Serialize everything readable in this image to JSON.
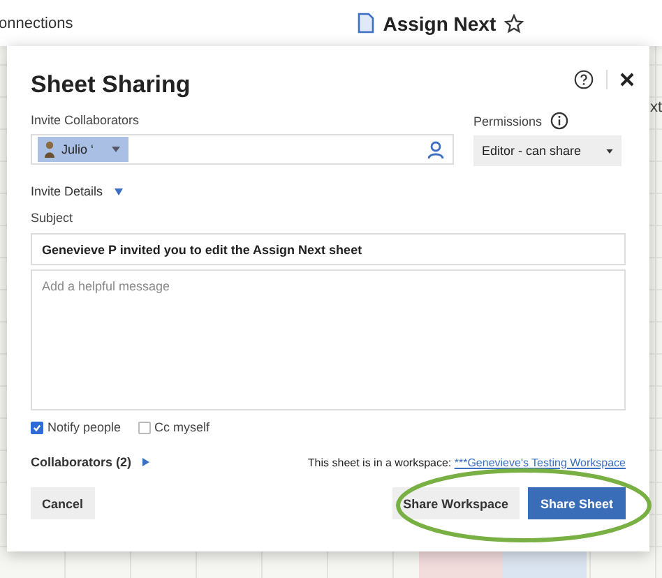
{
  "background": {
    "breadcrumb": "onnections",
    "sheet_title": "Assign Next",
    "right_fragment": "xt"
  },
  "dialog": {
    "title": "Sheet Sharing",
    "invite": {
      "label": "Invite Collaborators",
      "chips": [
        {
          "name": "Julio ‘"
        }
      ]
    },
    "permissions": {
      "label": "Permissions",
      "value": "Editor - can share"
    },
    "invite_details": {
      "label": "Invite Details",
      "expanded": true
    },
    "subject": {
      "label": "Subject",
      "value": "Genevieve P invited you to edit the Assign Next sheet"
    },
    "message": {
      "placeholder": "Add a helpful message"
    },
    "options": [
      {
        "label": "Notify people",
        "checked": true
      },
      {
        "label": "Cc myself",
        "checked": false
      }
    ],
    "collaborators": {
      "label": "Collaborators (2)",
      "expanded": false
    },
    "workspace_note": {
      "text": "This sheet is in a workspace:",
      "link": "***Genevieve's Testing Workspace"
    },
    "buttons": [
      {
        "label": "Cancel",
        "kind": "secondary"
      },
      {
        "label": "Share Workspace",
        "kind": "secondary"
      },
      {
        "label": "Share Sheet",
        "kind": "primary"
      }
    ],
    "highlight_buttons": true
  }
}
